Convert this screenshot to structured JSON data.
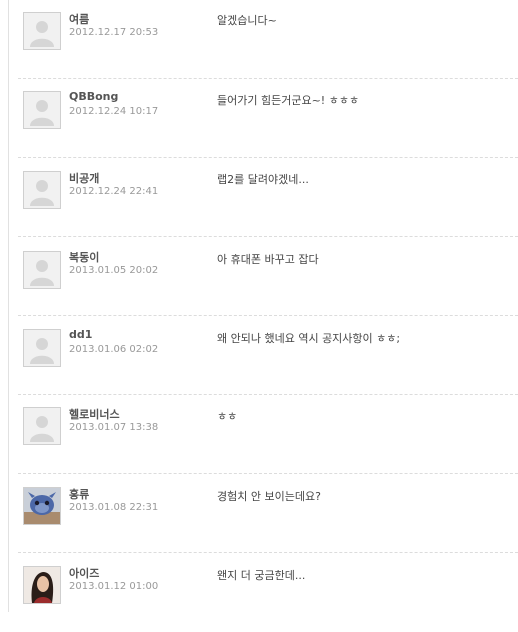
{
  "comments": [
    {
      "author": "여름",
      "date": "2012.12.17 20:53",
      "text": "알겠습니다~",
      "avatar": "default-avatar-icon"
    },
    {
      "author": "QBBong",
      "date": "2012.12.24 10:17",
      "text": "들어가기 힘든거군요~! ㅎㅎㅎ",
      "avatar": "default-avatar-icon"
    },
    {
      "author": "비공개",
      "date": "2012.12.24 22:41",
      "text": "랩2를 달려야겠네...",
      "avatar": "default-avatar-icon"
    },
    {
      "author": "복동이",
      "date": "2013.01.05 20:02",
      "text": "아 휴대폰 바꾸고 잡다",
      "avatar": "default-avatar-icon"
    },
    {
      "author": "dd1",
      "date": "2013.01.06 02:02",
      "text": "왜 안되나 했네요  역시 공지사항이 ㅎㅎ;",
      "avatar": "default-avatar-icon"
    },
    {
      "author": "헬로비너스",
      "date": "2013.01.07 13:38",
      "text": "ㅎㅎ",
      "avatar": "default-avatar-icon"
    },
    {
      "author": "홍류",
      "date": "2013.01.08 22:31",
      "text": "경험치 안 보이는데요?",
      "avatar": "character-avatar-photo"
    },
    {
      "author": "아이즈",
      "date": "2013.01.12 01:00",
      "text": "왠지 더 궁금한데...",
      "avatar": "person-avatar-photo"
    }
  ],
  "colors": {
    "name": "#555555",
    "date": "#999999",
    "text": "#444444",
    "separator": "#dcdcdc"
  }
}
